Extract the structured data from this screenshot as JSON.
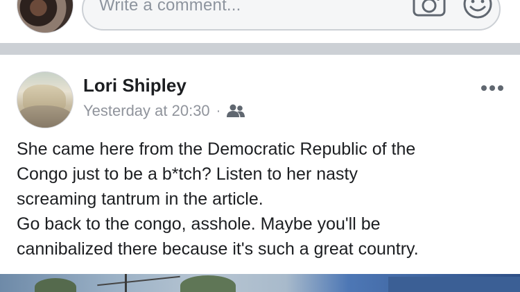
{
  "composer": {
    "placeholder": "Write a comment...",
    "camera_icon": "camera-icon",
    "emoji_icon": "smiley-icon"
  },
  "post": {
    "author": "Lori Shipley",
    "timestamp": "Yesterday at 20:30",
    "separator": "·",
    "audience_icon": "friends-icon",
    "more_icon": "more-horizontal-icon",
    "body_lines": [
      "She came here from the Democratic Republic of the",
      "Congo just to be a b*tch? Listen to her nasty",
      "screaming tantrum in the article.",
      "Go back to the congo, asshole. Maybe you'll be",
      "cannibalized there because it's such a great country."
    ]
  },
  "colors": {
    "divider": "#ccd0d5",
    "meta_text": "#90949c",
    "icon_gray": "#606770"
  }
}
